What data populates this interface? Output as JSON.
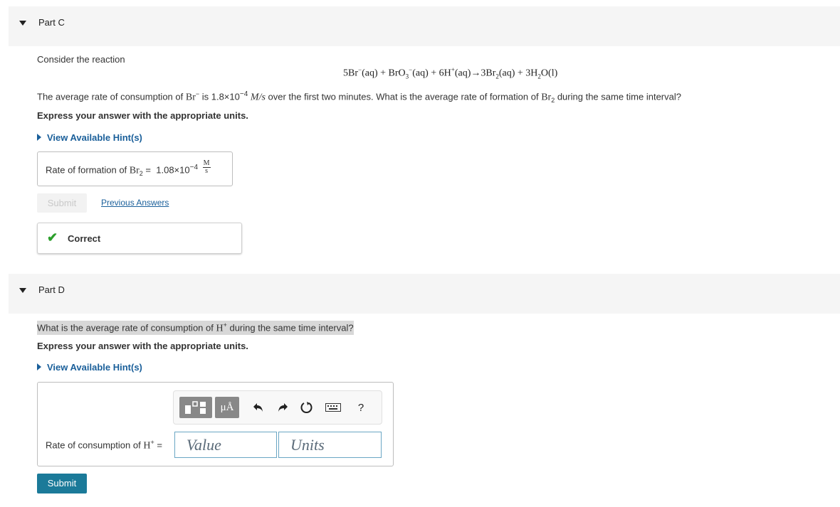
{
  "part_c": {
    "title": "Part C",
    "intro": "Consider the reaction",
    "equation": {
      "t1": "5Br",
      "t1_sup": "−",
      "t2": "(aq) + BrO",
      "t2_sub": "3",
      "t2_sup": "−",
      "t3": "(aq) + 6H",
      "t3_sup": "+",
      "t4": "(aq)→3Br",
      "t4_sub": "2",
      "t5": "(aq) + 3H",
      "t5_sub": "2",
      "t6": "O(l)"
    },
    "question": {
      "part1": "The average rate of consumption of ",
      "species1": "Br",
      "species1_sup": "−",
      "part2": " is 1.8×10",
      "exp": "−4",
      "unit": "M/s",
      "part3": " over the first two minutes. What is the average rate of formation of ",
      "species2": "Br",
      "species2_sub": "2",
      "part4": " during the same time interval?"
    },
    "instruction": "Express your answer with the appropriate units.",
    "hint_label": "View Available Hint(s)",
    "answer": {
      "label": "Rate of formation of ",
      "species": "Br",
      "species_sub": "2",
      "equals": " = ",
      "value": "1.08×10",
      "exp": "−4",
      "unit_num": "M",
      "unit_den": "s"
    },
    "submit_label": "Submit",
    "previous_answers_label": "Previous Answers",
    "feedback_label": "Correct"
  },
  "part_d": {
    "title": "Part D",
    "question": {
      "part1": "What is the average rate of consumption of ",
      "species": "H",
      "species_sup": "+",
      "part2": " during the same time interval?"
    },
    "instruction": "Express your answer with the appropriate units.",
    "hint_label": "View Available Hint(s)",
    "toolbar": {
      "templates_icon": "templates-icon",
      "units_label": "μÅ",
      "undo_icon": "undo-icon",
      "redo_icon": "redo-icon",
      "reset_icon": "reset-icon",
      "keyboard_icon": "keyboard-icon",
      "help_label": "?"
    },
    "answer": {
      "label": "Rate of consumption of ",
      "species": "H",
      "species_sup": "+",
      "equals": " ="
    },
    "value_placeholder": "Value",
    "units_placeholder": "Units",
    "submit_label": "Submit"
  }
}
